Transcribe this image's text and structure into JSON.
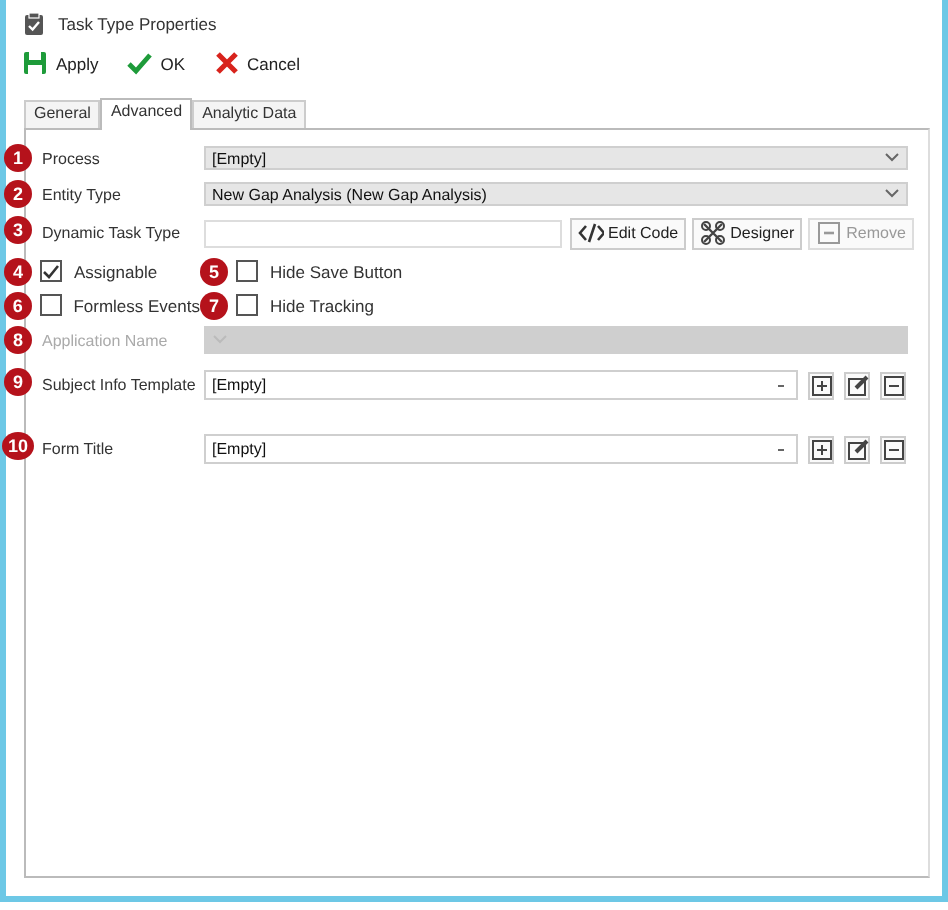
{
  "window": {
    "title": "Task Type Properties"
  },
  "toolbar": [
    {
      "kind": "apply",
      "label": "Apply"
    },
    {
      "kind": "ok",
      "label": "OK"
    },
    {
      "kind": "cancel",
      "label": "Cancel"
    }
  ],
  "tabs": [
    {
      "label": "General",
      "selected": false
    },
    {
      "label": "Advanced",
      "selected": true
    },
    {
      "label": "Analytic Data",
      "selected": false
    }
  ],
  "rows": [
    {
      "kind": "select",
      "number": "1",
      "label": "Process",
      "value": "[Empty]",
      "disabled": false
    },
    {
      "kind": "select",
      "number": "2",
      "label": "Entity Type",
      "value": "New Gap Analysis (New Gap Analysis)",
      "disabled": false
    },
    {
      "kind": "code",
      "number": "3",
      "label": "Dynamic Task Type",
      "buttons": [
        {
          "kind": "code",
          "label": "Edit Code",
          "disabled": false
        },
        {
          "kind": "designer",
          "label": "Designer",
          "disabled": false
        },
        {
          "kind": "remove",
          "label": "Remove",
          "disabled": true
        }
      ]
    },
    {
      "kind": "checks",
      "items": [
        {
          "number": "4",
          "label": "Assignable",
          "checked": true
        },
        {
          "number": "5",
          "label": "Hide Save Button",
          "checked": false
        }
      ]
    },
    {
      "kind": "checks",
      "items": [
        {
          "number": "6",
          "label": "Formless Events",
          "checked": false
        },
        {
          "number": "7",
          "label": "Hide Tracking",
          "checked": false
        }
      ]
    },
    {
      "kind": "select",
      "number": "8",
      "label": "Application Name",
      "disabled": true
    },
    {
      "kind": "template",
      "number": "9",
      "label": "Subject Info Template",
      "value": "[Empty]"
    },
    {
      "kind": "template",
      "number": "10",
      "label": "Form Title",
      "value": "[Empty]"
    }
  ]
}
